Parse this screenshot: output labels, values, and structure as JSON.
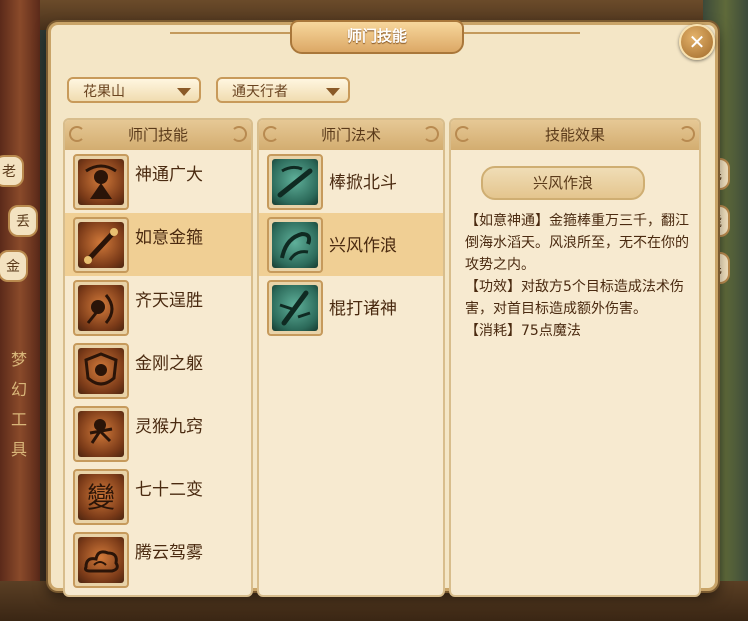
{
  "dialog": {
    "title": "师门技能",
    "close_icon": "close-icon"
  },
  "filters": {
    "school": "花果山",
    "role": "通天行者"
  },
  "panels": {
    "skills": {
      "header": "师门技能",
      "items": [
        {
          "label": "神通广大",
          "icon": "monkey-king-icon"
        },
        {
          "label": "如意金箍",
          "icon": "golden-staff-icon"
        },
        {
          "label": "齐天逞胜",
          "icon": "monkey-bow-icon"
        },
        {
          "label": "金刚之躯",
          "icon": "shield-monkey-icon"
        },
        {
          "label": "灵猴九窍",
          "icon": "leaping-monkey-icon"
        },
        {
          "label": "七十二变",
          "icon": "transform-glyph-icon"
        },
        {
          "label": "腾云驾雾",
          "icon": "cloud-icon"
        }
      ],
      "selected_index": 1
    },
    "spells": {
      "header": "师门法术",
      "items": [
        {
          "label": "棒掀北斗",
          "icon": "staff-swing-icon"
        },
        {
          "label": "兴风作浪",
          "icon": "wave-whirl-icon"
        },
        {
          "label": "棍打诸神",
          "icon": "staff-strike-icon"
        }
      ],
      "selected_index": 1
    },
    "effect": {
      "header": "技能效果",
      "title": "兴风作浪",
      "lines": [
        "【如意神通】金箍棒重万三千，翻江倒海水滔天。风浪所至，无不在你的攻势之内。",
        "【功效】对敌方5个目标造成法术伤害，对首目标造成额外伤害。",
        "【消耗】75点魔法"
      ]
    }
  },
  "background": {
    "vertical_text": "梦幻工具",
    "side_tabs_left": [
      "老",
      "丢",
      "金"
    ],
    "side_tabs_right": [
      "毛",
      "能",
      "毛"
    ]
  },
  "colors": {
    "selected_row": "#f0cf94",
    "panel_bg": "#f7ead0",
    "dialog_bg": "#f4e6c6"
  }
}
